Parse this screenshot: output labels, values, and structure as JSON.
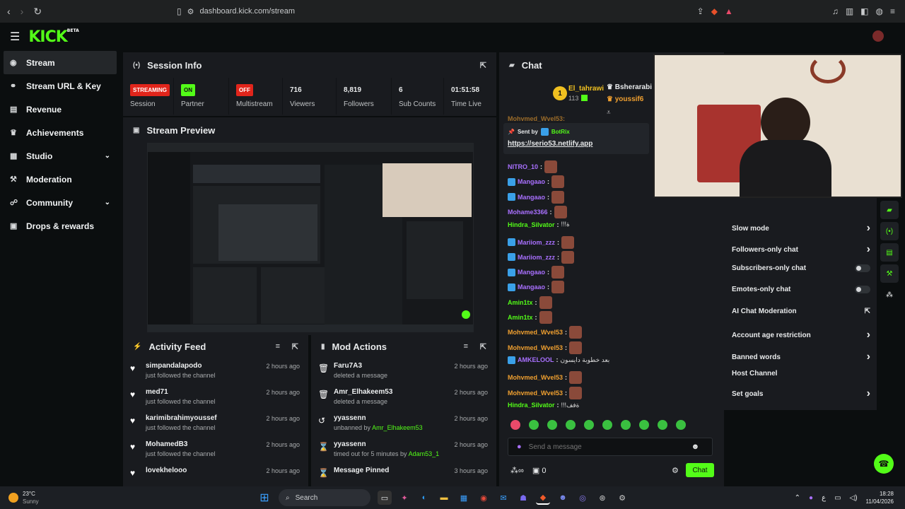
{
  "browser": {
    "url": "dashboard.kick.com/stream"
  },
  "logo": {
    "text": "KICK",
    "beta": "BETA"
  },
  "sidebar": {
    "items": [
      {
        "label": "Stream",
        "icon": "radio-icon"
      },
      {
        "label": "Stream URL & Key",
        "icon": "link-icon"
      },
      {
        "label": "Revenue",
        "icon": "chart-icon"
      },
      {
        "label": "Achievements",
        "icon": "trophy-icon"
      },
      {
        "label": "Studio",
        "icon": "studio-icon"
      },
      {
        "label": "Moderation",
        "icon": "hammer-icon"
      },
      {
        "label": "Community",
        "icon": "people-icon"
      },
      {
        "label": "Drops & rewards",
        "icon": "gift-icon"
      }
    ]
  },
  "session": {
    "title": "Session Info",
    "streaming": "STREAMING",
    "session_label": "Session",
    "partner_badge": "ON",
    "partner_label": "Partner",
    "multistream_badge": "OFF",
    "multistream_label": "Multistream",
    "viewers": "716",
    "viewers_label": "Viewers",
    "followers": "8,819",
    "followers_label": "Followers",
    "subs": "6",
    "subs_label": "Sub Counts",
    "time": "01:51:58",
    "time_label": "Time Live"
  },
  "preview": {
    "title": "Stream Preview"
  },
  "activity": {
    "title": "Activity Feed",
    "items": [
      {
        "name": "simpandalapodo",
        "sub": "just followed the channel",
        "time": "2 hours ago"
      },
      {
        "name": "med71",
        "sub": "just followed the channel",
        "time": "2 hours ago"
      },
      {
        "name": "karimibrahimyoussef",
        "sub": "just followed the channel",
        "time": "2 hours ago"
      },
      {
        "name": "MohamedB3",
        "sub": "just followed the channel",
        "time": "2 hours ago"
      },
      {
        "name": "lovekhelooo",
        "sub": "",
        "time": "2 hours ago"
      }
    ]
  },
  "mod": {
    "title": "Mod Actions",
    "items": [
      {
        "name": "Faru7A3",
        "sub": "deleted a message",
        "by": "",
        "time": "2 hours ago"
      },
      {
        "name": "Amr_Elhakeem53",
        "sub": "deleted a message",
        "by": "",
        "time": "2 hours ago"
      },
      {
        "name": "yyassenn",
        "sub": "unbanned by ",
        "by": "Amr_Elhakeem53",
        "time": "2 hours ago"
      },
      {
        "name": "yyassenn",
        "sub": "timed out for 5 minutes by ",
        "by": "Adam53_1",
        "time": "2 hours ago"
      },
      {
        "name": "Message Pinned",
        "sub": "",
        "by": "",
        "time": "3 hours ago"
      }
    ]
  },
  "chat": {
    "title": "Chat",
    "gifter1": {
      "name": "El_tahrawi",
      "count": "113"
    },
    "gifter2": "Bsherarabi",
    "gifter3": "youssif6",
    "partial": "Mohvmed_Wvel53:",
    "pinned": {
      "sent_by": "Sent by",
      "bot": "BotRix",
      "link": "https://serio53.netlify.app"
    },
    "messages": [
      {
        "user": "NITRO_10",
        "color": "#a970ff",
        "text": ""
      },
      {
        "user": "Mangaao",
        "color": "#a970ff",
        "text": ""
      },
      {
        "user": "Mangaao",
        "color": "#a970ff",
        "text": ""
      },
      {
        "user": "Mohame3366",
        "color": "#a970ff",
        "text": ""
      },
      {
        "user": "Hindra_Silvator",
        "color": "#53fc18",
        "text": "!!!ة"
      },
      {
        "user": "Mariiom_zzz",
        "color": "#a970ff",
        "text": ""
      },
      {
        "user": "Mariiom_zzz",
        "color": "#a970ff",
        "text": ""
      },
      {
        "user": "Mangaao",
        "color": "#a970ff",
        "text": ""
      },
      {
        "user": "Mangaao",
        "color": "#a970ff",
        "text": ""
      },
      {
        "user": "Amin1tx",
        "color": "#53fc18",
        "text": ""
      },
      {
        "user": "Amin1tx",
        "color": "#53fc18",
        "text": ""
      },
      {
        "user": "Mohvmed_Wvel53",
        "color": "#f0a030",
        "text": ""
      },
      {
        "user": "Mohvmed_Wvel53",
        "color": "#f0a030",
        "text": ""
      },
      {
        "user": "AMKELOOL",
        "color": "#a970ff",
        "text": "بعد خطوبة دايسون"
      },
      {
        "user": "Mohvmed_Wvel53",
        "color": "#f0a030",
        "text": ""
      },
      {
        "user": "Mohvmed_Wvel53",
        "color": "#f0a030",
        "text": ""
      },
      {
        "user": "Hindra_Silvator",
        "color": "#53fc18",
        "text": "!!!ةفف"
      }
    ],
    "placeholder": "Send a message",
    "users_count": "0",
    "send": "Chat"
  },
  "settings": [
    {
      "label": "Slow mode",
      "ctrl": "chev"
    },
    {
      "label": "Followers-only chat",
      "ctrl": "chev"
    },
    {
      "label": "Subscribers-only chat",
      "ctrl": "toggle"
    },
    {
      "label": "Emotes-only chat",
      "ctrl": "toggle"
    },
    {
      "label": "AI Chat Moderation",
      "ctrl": "ext"
    },
    {
      "label": "Account age restriction",
      "ctrl": "chev"
    },
    {
      "label": "Banned words",
      "ctrl": "chev"
    },
    {
      "label": "Host Channel",
      "ctrl": "none"
    },
    {
      "label": "Set goals",
      "ctrl": "chev"
    }
  ],
  "taskbar": {
    "weather_temp": "23°C",
    "weather_desc": "Sunny",
    "search": "Search",
    "time": "18:28",
    "date": "11/04/2026"
  },
  "colors": {
    "accent": "#53fc18",
    "bg": "#0b0e0f",
    "panel": "#191b1f",
    "danger": "#e1251b"
  }
}
